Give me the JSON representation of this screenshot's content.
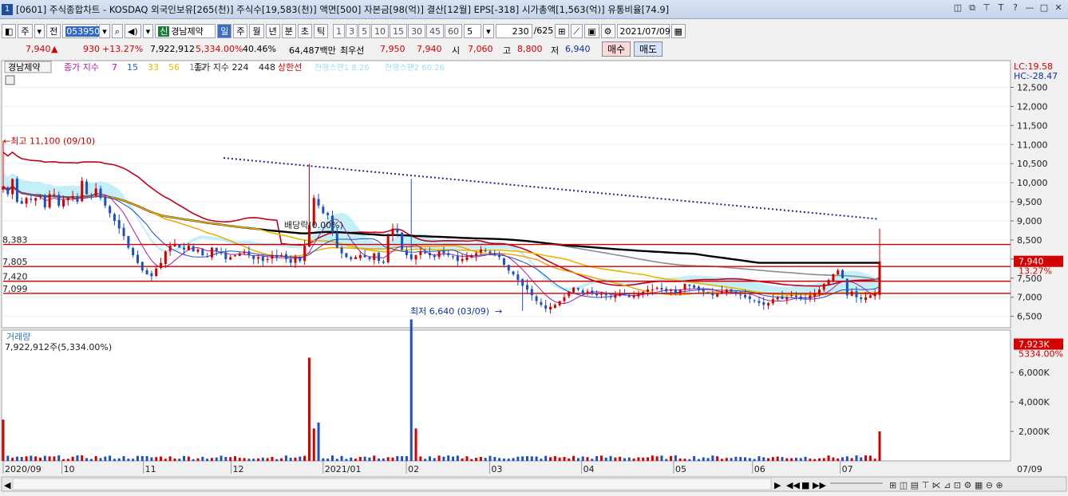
{
  "window": {
    "screen_no": "1",
    "title": "[0601] 주식종합차트 - KOSDAQ 외국인보유[265(천)] 주식수[19,583(천)] 액면[500] 자본금[98(억)] 결산[12월] EPS[-318] 시가총액[1,563(억)] 유통비율[74.9]"
  },
  "toolbar": {
    "mode_label": "주",
    "all_label": "전",
    "code_value": "053950",
    "stock_badge": "신",
    "stock_name": "경남제약",
    "periods": [
      "일",
      "주",
      "월",
      "년",
      "분",
      "초",
      "틱"
    ],
    "selected_period": "일",
    "intervals": [
      "1",
      "3",
      "5",
      "10",
      "15",
      "30",
      "45",
      "60"
    ],
    "custom_interval": "5",
    "page_count": "230",
    "page_total": "/625",
    "date_value": "2021/07/09"
  },
  "pricebar": {
    "price": "7,940",
    "change": "930",
    "change_pct": "+13.27%",
    "volume": "7,922,912",
    "volume_ratio": "5,334.00%",
    "turnover": "40.46%",
    "amount": "64,487백만",
    "best_ask_label": "최우선",
    "best_ask": "7,950",
    "best_bid": "7,940",
    "open_label": "시",
    "open": "7,060",
    "high_label": "고",
    "high": "8,800",
    "low_label": "저",
    "low": "6,940",
    "buy_label": "매수",
    "sell_label": "매도"
  },
  "legend": {
    "stock_name": "경남제약",
    "ma_label": "종가 지수",
    "ma_periods": [
      {
        "label": "7",
        "color": "#a020a0"
      },
      {
        "label": "15",
        "color": "#2060d0"
      },
      {
        "label": "33",
        "color": "#e6b800"
      },
      {
        "label": "56",
        "color": "#e6b800"
      },
      {
        "label": "112",
        "color": "#808080"
      }
    ],
    "ma2_label": "종가 지수 224",
    "ma3_label": "448",
    "upper_label": "상한선",
    "cloud1_label": "전행스팬1 8.26",
    "cloud2_label": "전행스팬2 60.26",
    "lc_label": "LC:19.58",
    "hc_label": "HC:-28.47"
  },
  "colors": {
    "up": "#d40000",
    "down": "#1e50c0",
    "cloud": "#b9ecf7",
    "ma_long": "#000000",
    "ma_gray": "#8c8c8c",
    "ma_yellow": "#e6b800",
    "ma_orange": "#f0a000",
    "ma_purple": "#a020a0",
    "envelope": "#c00020",
    "hline": "#d40000",
    "trend": "#1a2a8a"
  },
  "chart_data": [
    {
      "type": "candlestick",
      "title": "",
      "ylim": [
        6200,
        13200
      ],
      "y_ticks": [
        6500,
        7000,
        7500,
        8000,
        8500,
        9000,
        9500,
        10000,
        10500,
        11000,
        11500,
        12000,
        12500
      ],
      "y_tick_labels": [
        "6,500",
        "7,000",
        "7,500",
        "8,000",
        "8,500",
        "9,000",
        "9,500",
        "10,000",
        "10,500",
        "11,000",
        "11,500",
        "12,000",
        "12,500"
      ],
      "x_labels": [
        "2020/09",
        "10",
        "11",
        "12",
        "2021/01",
        "02",
        "03",
        "04",
        "05",
        "06",
        "07"
      ],
      "x_end_label": "07/09",
      "horizontal_levels": [
        {
          "value": 8383,
          "label": "8,383"
        },
        {
          "value": 7805,
          "label": "7,805"
        },
        {
          "value": 7420,
          "label": "7,420"
        },
        {
          "value": 7099,
          "label": "7,099"
        }
      ],
      "annotations": [
        {
          "label": "←최고 11,100 (09/10)",
          "value": 11100
        },
        {
          "label": "최저 6,640 (03/09)",
          "value": 6640
        },
        {
          "label": "배당락(0.00%)",
          "value": 8900
        }
      ],
      "last_price_label": "7,940",
      "last_change_label": "13.27%",
      "series_close": [
        9900,
        9700,
        10100,
        9500,
        9450,
        9600,
        9550,
        9600,
        9650,
        9350,
        9700,
        9700,
        9400,
        9550,
        9600,
        9650,
        9500,
        10050,
        9700,
        9650,
        9850,
        9600,
        9400,
        9200,
        9000,
        8800,
        8600,
        8300,
        8100,
        7900,
        7700,
        7600,
        7550,
        7750,
        7900,
        8200,
        8350,
        8400,
        8300,
        8250,
        8350,
        8200,
        8250,
        8100,
        8050,
        8300,
        8200,
        8150,
        8000,
        8050,
        8100,
        8150,
        8200,
        8100,
        8000,
        8050,
        7950,
        8000,
        8100,
        8050,
        8100,
        8000,
        7900,
        8050,
        7950,
        8350,
        8900,
        9600,
        9400,
        9200,
        9150,
        8700,
        8300,
        8150,
        8050,
        8000,
        8050,
        8100,
        8050,
        8000,
        8150,
        7950,
        7900,
        8600,
        8800,
        8700,
        8250,
        8100,
        8000,
        8100,
        8200,
        8150,
        8100,
        8050,
        8200,
        8150,
        8100,
        8050,
        7950,
        8000,
        8050,
        8100,
        8150,
        8250,
        8200,
        8150,
        8100,
        8050,
        7850,
        7700,
        7600,
        7450,
        7300,
        7200,
        7050,
        6900,
        6800,
        6700,
        6750,
        6800,
        6900,
        7000,
        7150,
        7250,
        7200,
        7100,
        7150,
        7100,
        7050,
        7100,
        7050,
        7000,
        7050,
        7100,
        7050,
        7000,
        7050,
        7100,
        7150,
        7200,
        7200,
        7250,
        7200,
        7150,
        7200,
        7100,
        7200,
        7350,
        7300,
        7250,
        7200,
        7150,
        7100,
        7050,
        7100,
        7150,
        7200,
        7150,
        7100,
        7050,
        7000,
        6950,
        6900,
        6850,
        6800,
        6850,
        6950,
        7000,
        6950,
        7000,
        7050,
        7000,
        6950,
        6950,
        7050,
        7100,
        7200,
        7350,
        7450,
        7600,
        7700,
        7500,
        7050,
        7150,
        7000,
        6950,
        7000,
        7050,
        7100,
        7940
      ],
      "volume_label": "거래량",
      "volume_summary": "7,922,912주(5,334.00%)",
      "volume_ylim": [
        0,
        8600
      ],
      "volume_ticks": [
        2000,
        4000,
        6000
      ],
      "volume_tick_labels": [
        "2,000K",
        "4,000K",
        "6,000K"
      ],
      "volume_last_label": "7,923K",
      "volume_last_pct": "5334.00%",
      "volume_spikes": [
        {
          "index": 0,
          "value": 2800
        },
        {
          "index": 66,
          "value": 7000
        },
        {
          "index": 67,
          "value": 2200
        },
        {
          "index": 68,
          "value": 2600
        },
        {
          "index": 88,
          "value": 9600
        },
        {
          "index": 89,
          "value": 2200
        },
        {
          "index": 189,
          "value": 2000
        },
        {
          "index": 196,
          "value": 7923
        }
      ]
    }
  ]
}
